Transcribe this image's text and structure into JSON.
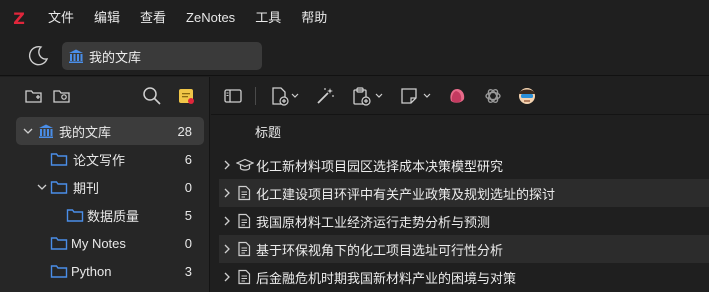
{
  "app": {
    "logo_letter": "Z",
    "accent": "#e0263b"
  },
  "menubar": {
    "items": [
      "文件",
      "编辑",
      "查看",
      "ZeNotes",
      "工具",
      "帮助"
    ]
  },
  "tab": {
    "label": "我的文库"
  },
  "left_toolbar": {
    "icons": [
      "new-collection-icon",
      "new-saved-search-icon",
      "search-icon",
      "notes-badge-icon"
    ]
  },
  "collections": [
    {
      "label": "我的文库",
      "count": "28",
      "selected": true,
      "expanded": true,
      "icon": "library-icon",
      "level": 0
    },
    {
      "label": "论文写作",
      "count": "6",
      "icon": "folder-icon",
      "level": 1
    },
    {
      "label": "期刊",
      "count": "0",
      "icon": "folder-icon",
      "level": 1,
      "expanded": true
    },
    {
      "label": "数据质量",
      "count": "5",
      "icon": "folder-icon",
      "level": 2
    },
    {
      "label": "My Notes",
      "count": "0",
      "icon": "folder-icon",
      "level": 1
    },
    {
      "label": "Python",
      "count": "3",
      "icon": "folder-icon",
      "level": 1
    }
  ],
  "right_toolbar": {
    "icons": [
      "toggle-pane-icon",
      "new-item-icon",
      "magic-wand-icon",
      "add-attachment-icon",
      "new-note-icon",
      "red-blob-icon",
      "openai-icon",
      "avatar-icon"
    ]
  },
  "items_header": {
    "title_column": "标题"
  },
  "items": [
    {
      "title": "化工新材料项目园区选择成本决策模型研究",
      "icon": "graduation-cap-icon"
    },
    {
      "title": "化工建设项目环评中有关产业政策及规划选址的探讨",
      "icon": "document-icon"
    },
    {
      "title": "我国原材料工业经济运行走势分析与预测",
      "icon": "document-icon"
    },
    {
      "title": "基于环保视角下的化工项目选址可行性分析",
      "icon": "document-icon"
    },
    {
      "title": "后金融危机时期我国新材料产业的困境与对策",
      "icon": "document-icon"
    }
  ]
}
